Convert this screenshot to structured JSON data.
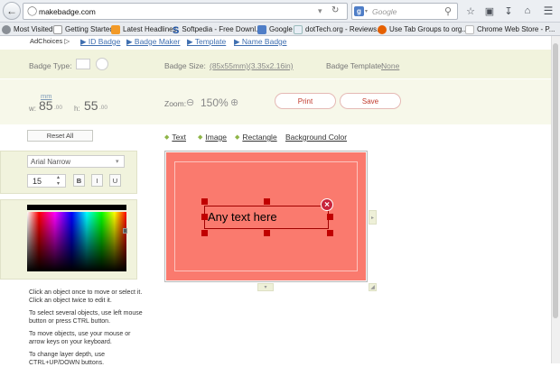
{
  "browser": {
    "url": "makebadge.com",
    "search_placeholder": "Google",
    "search_engine_icon": "google-icon",
    "bookmarks": [
      {
        "label": "Most Visited",
        "icon": "gear-icon"
      },
      {
        "label": "Getting Started",
        "icon": "page-icon"
      },
      {
        "label": "Latest Headlines",
        "icon": "rss-icon"
      },
      {
        "label": "Softpedia - Free Downl...",
        "icon": "softpedia-icon"
      },
      {
        "label": "Google",
        "icon": "google-icon"
      },
      {
        "label": "dotTech.org - Reviews...",
        "icon": "dottech-icon"
      },
      {
        "label": "Use Tab Groups to org...",
        "icon": "firefox-icon"
      },
      {
        "label": "Chrome Web Store - P...",
        "icon": "chrome-icon"
      }
    ]
  },
  "ads": {
    "adchoices": "AdChoices ▷",
    "links": [
      "▶ ID Badge",
      "▶ Badge Maker",
      "▶ Template",
      "▶ Name Badge"
    ]
  },
  "badge": {
    "type_label": "Badge Type:",
    "size_label": "Badge Size:",
    "size_value": "(85x55mm)(3.35x2.16in)",
    "template_label": "Badge Template:",
    "template_value": "None",
    "unit": "mm",
    "w_label": "w:",
    "w_value": "85",
    "w_decimal": ".00",
    "h_label": "h:",
    "h_value": "55",
    "h_decimal": ".00",
    "zoom_label": "Zoom:",
    "zoom_value": "150%",
    "print_label": "Print",
    "save_label": "Save"
  },
  "tools": {
    "reset_label": "Reset All",
    "items": [
      "Text",
      "Image",
      "Rectangle",
      "Background Color"
    ]
  },
  "font": {
    "family": "Arial Narrow",
    "size": "15",
    "bold": "B",
    "italic": "I",
    "underline": "U"
  },
  "canvas": {
    "text": "Any text here",
    "background_color": "#fa7a6e",
    "selection_color": "#c00000"
  },
  "help": [
    "Click an object once to move or select it. Click an object twice to edit it.",
    "To select several objects, use left mouse button or press CTRL button.",
    "To move objects, use your mouse or arrow keys on your keyboard.",
    "To change layer depth, use CTRL+UP/DOWN buttons."
  ]
}
